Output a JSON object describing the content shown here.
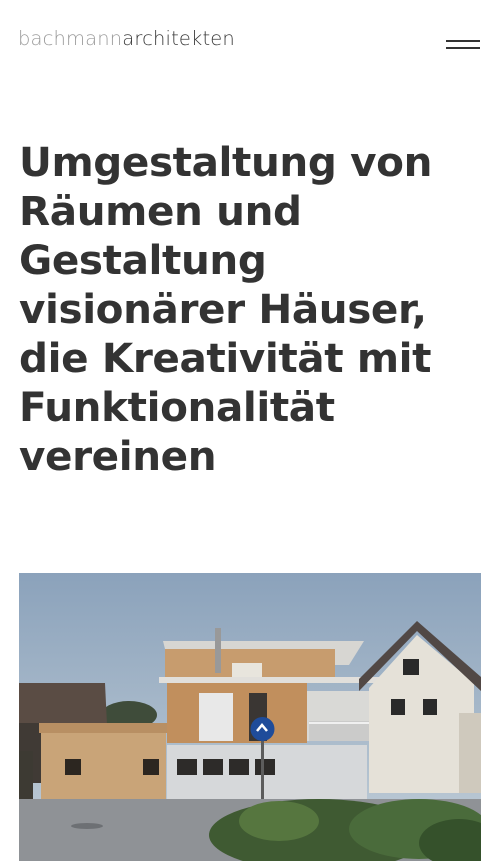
{
  "header": {
    "logo_light": "bachmann",
    "logo_dark": "architekten",
    "menu_icon": "hamburger-icon"
  },
  "hero": {
    "headline": "Umgestaltung von Räumen und Gestaltung visionärer Häuser, die Kreativität mit Funktionalität vereinen"
  },
  "colors": {
    "text": "#333333",
    "logo_light": "#9b9b9b",
    "background": "#ffffff"
  }
}
